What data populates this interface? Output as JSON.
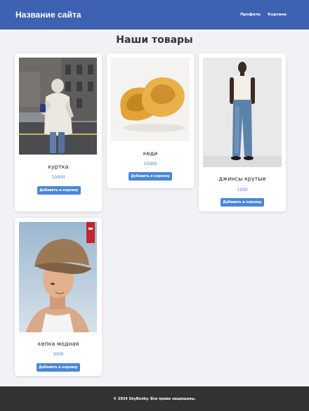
{
  "header": {
    "site_title": "Название сайта",
    "nav": [
      "Профиль",
      "Корзина"
    ],
    "color": "#3c62b1"
  },
  "main": {
    "heading": "Наши товары",
    "add_to_cart_label": "Добавить в корзину",
    "products": [
      {
        "name": "куртка",
        "price": "10000",
        "image": "jacket-photo"
      },
      {
        "name": "кеди",
        "price": "15000",
        "image": "slippers-photo"
      },
      {
        "name": "джинсы крутые",
        "price": "1200",
        "image": "jeans-photo"
      },
      {
        "name": "кепка модная",
        "price": "3000",
        "image": "cap-photo"
      }
    ]
  },
  "footer": {
    "copyright": "© 2024 SkyBooky. Все права защищены."
  },
  "colors": {
    "accent": "#4a86d6",
    "price": "#4a7ec8",
    "footer_bg": "#333333",
    "page_bg": "#f2f2f6"
  }
}
